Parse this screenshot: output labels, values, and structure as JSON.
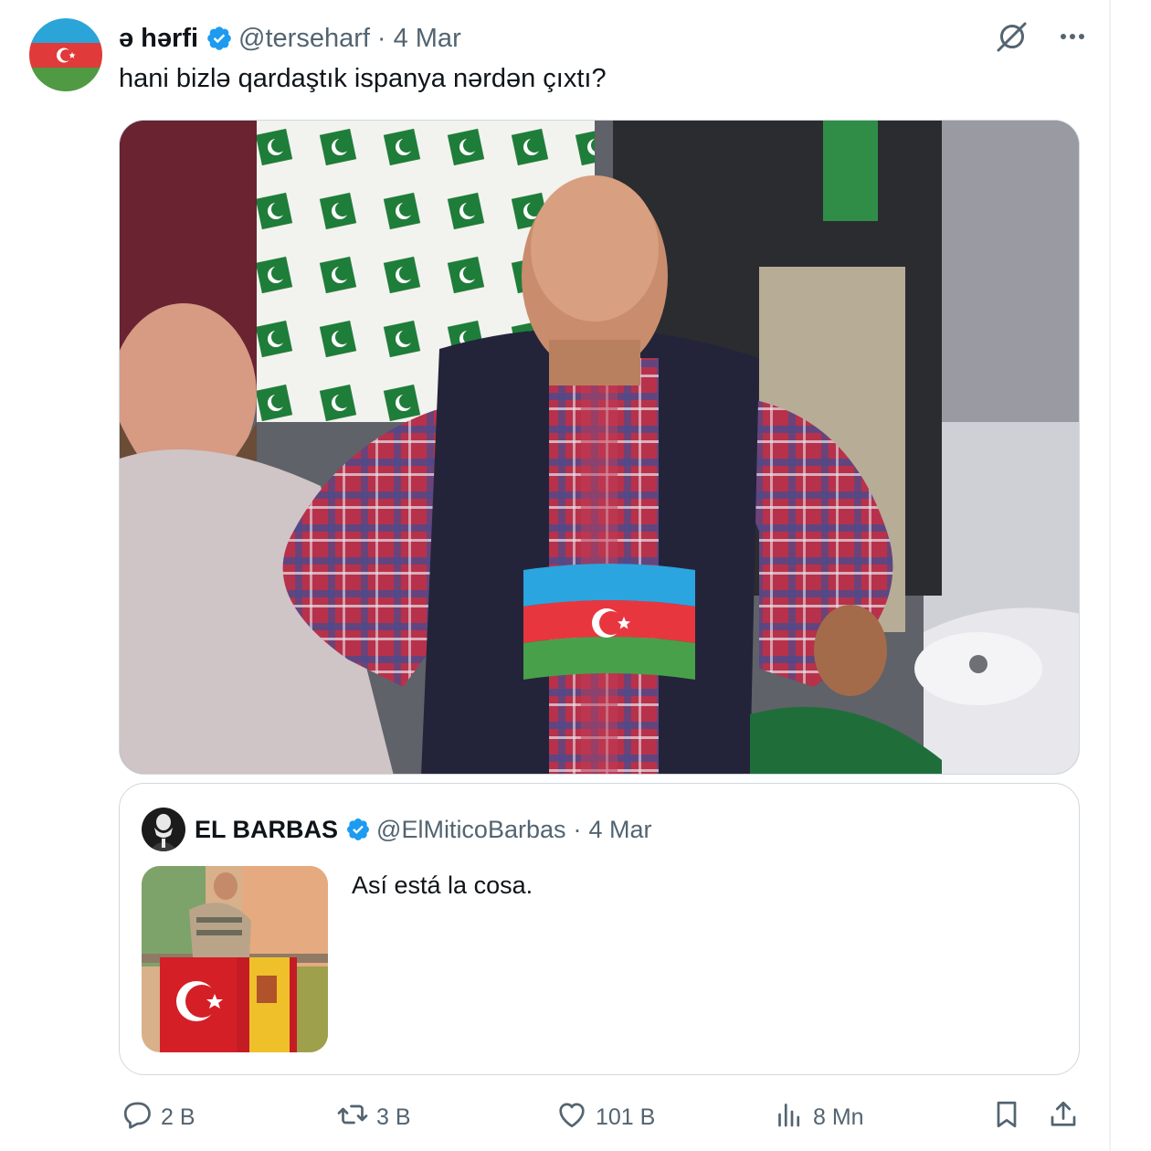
{
  "tweet": {
    "author": {
      "display_name": "ə hərfi",
      "handle": "@terseharf",
      "verified": true
    },
    "separator": "·",
    "date": "4 Mar",
    "text": "hani bizlə qardaştık ispanya nərdən çıxtı?",
    "top_icons": [
      "grok-icon",
      "more-icon"
    ]
  },
  "quoted_tweet": {
    "author": {
      "display_name": "EL BARBAS",
      "handle": "@ElMiticoBarbas",
      "verified": true
    },
    "separator": "·",
    "date": "4 Mar",
    "text": "Así está la cosa."
  },
  "actions": {
    "replies": "2 B",
    "reposts": "3 B",
    "likes": "101 B",
    "views": "8 Mn"
  },
  "colors": {
    "text_primary": "#0f1419",
    "text_secondary": "#536471",
    "border": "#cfd9de",
    "verified_blue": "#1d9bf0",
    "az_blue": "#00b5e2",
    "az_red": "#ef3340",
    "az_green": "#509e2f"
  }
}
